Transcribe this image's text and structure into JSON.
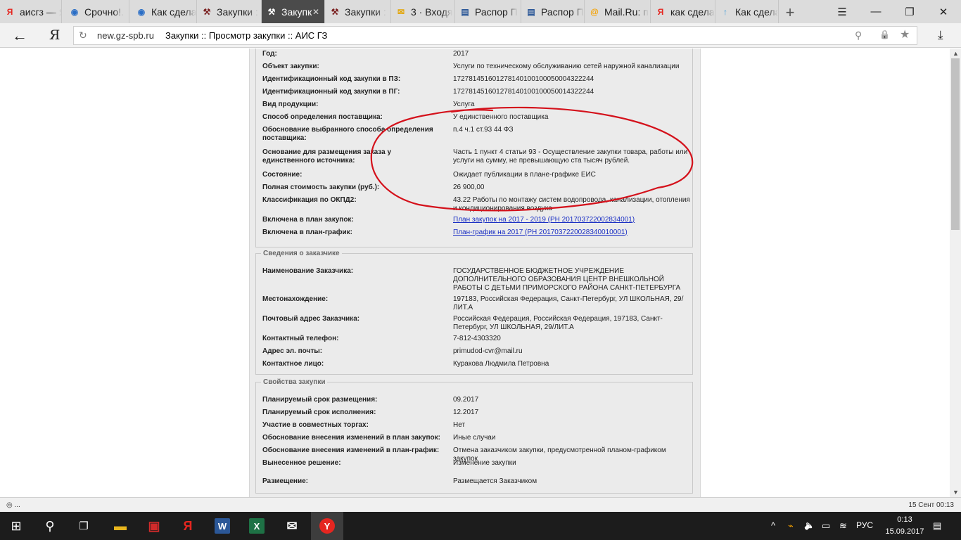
{
  "browser": {
    "tabs": [
      {
        "label": "аисгз — Я",
        "icon": "yandex-icon",
        "icon_glyph": "Я",
        "icon_color": "#e52620"
      },
      {
        "label": "Срочно!.",
        "icon": "globe-icon",
        "icon_glyph": "◉",
        "icon_color": "#2a6ec6"
      },
      {
        "label": "Как сдела",
        "icon": "globe-icon",
        "icon_glyph": "◉",
        "icon_color": "#2a6ec6"
      },
      {
        "label": "Закупки :",
        "icon": "gavel-icon",
        "icon_glyph": "⚒",
        "icon_color": "#7a1f1f"
      },
      {
        "label": "Закупк",
        "icon": "gavel-icon",
        "icon_glyph": "⚒",
        "icon_color": "#ffffff"
      },
      {
        "label": "Закупки :",
        "icon": "gavel-icon",
        "icon_glyph": "⚒",
        "icon_color": "#7a1f1f"
      },
      {
        "label": "3 · Входя",
        "icon": "mail-icon",
        "icon_glyph": "✉",
        "icon_color": "#e3a400"
      },
      {
        "label": "Распор П",
        "icon": "doc-icon",
        "icon_glyph": "▤",
        "icon_color": "#2b5797"
      },
      {
        "label": "Распор П",
        "icon": "doc-icon",
        "icon_glyph": "▤",
        "icon_color": "#2b5797"
      },
      {
        "label": "Mail.Ru: п",
        "icon": "at-icon",
        "icon_glyph": "@",
        "icon_color": "#f5a100"
      },
      {
        "label": "как сдела",
        "icon": "yandex-icon",
        "icon_glyph": "Я",
        "icon_color": "#e52620"
      },
      {
        "label": "Как сдела",
        "icon": "upload-icon",
        "icon_glyph": "↑",
        "icon_color": "#3a9ad9"
      }
    ],
    "new_tab": "+",
    "window_controls": {
      "menu": "☰",
      "minimize": "—",
      "restore": "❐",
      "close": "✕"
    },
    "back": "←",
    "yandex_logo": "Я",
    "reload": "↻",
    "domain": "new.gz-spb.ru",
    "page_title": "Закупки :: Просмотр закупки :: АИС ГЗ",
    "address_icons": {
      "search": "⚲",
      "lock": "🔒",
      "bookmark": "★"
    },
    "download": "⤓"
  },
  "procurement": {
    "rows": [
      {
        "key": "Год:",
        "value": "2017"
      },
      {
        "key": "Объект закупки:",
        "value": "Услуги по техническому обслуживанию сетей наружной канализации"
      },
      {
        "key": "Идентификационный код закупки в ПЗ:",
        "value": "172781451601278140100100050004322244"
      },
      {
        "key": "Идентификационный код закупки в ПГ:",
        "value": "172781451601278140100100050014322244"
      },
      {
        "key": "Вид продукции:",
        "value": "Услуга"
      },
      {
        "key": "Способ определения поставщика:",
        "value": "У единственного поставщика"
      },
      {
        "key": "Обоснование выбранного способа определения поставщика:",
        "value": "п.4 ч.1 ст.93 44 ФЗ"
      },
      {
        "key": "Основание для размещения заказа у единственного источника:",
        "value": "Часть 1 пункт 4 статьи 93 - Осуществление закупки товара, работы или услуги на сумму, не превышающую ста тысяч рублей."
      },
      {
        "key": "Состояние:",
        "value": "Ожидает публикации в плане-графике ЕИС"
      },
      {
        "key": "Полная стоимость закупки (руб.):",
        "value": "26 900,00"
      },
      {
        "key": "Классификация по ОКПД2:",
        "value": "43.22 Работы по монтажу систем водопровода, канализации, отопления и кондиционирования воздуха"
      },
      {
        "key": "Включена в план закупок:",
        "value": "План закупок на 2017 - 2019 (РН 201703722002834001)"
      },
      {
        "key": "Включена в план-график:",
        "value": "План-график на 2017 (РН 2017037220028340010001)"
      }
    ]
  },
  "customer": {
    "legend": "Сведения о заказчике",
    "rows": [
      {
        "key": "Наименование Заказчика:",
        "value": "ГОСУДАРСТВЕННОЕ БЮДЖЕТНОЕ УЧРЕЖДЕНИЕ ДОПОЛНИТЕЛЬНОГО ОБРАЗОВАНИЯ ЦЕНТР ВНЕШКОЛЬНОЙ РАБОТЫ С ДЕТЬМИ ПРИМОРСКОГО РАЙОНА САНКТ-ПЕТЕРБУРГА"
      },
      {
        "key": "Местонахождение:",
        "value": "197183, Российская Федерация, Санкт-Петербург, УЛ ШКОЛЬНАЯ, 29/ ЛИТ.А"
      },
      {
        "key": "Почтовый адрес Заказчика:",
        "value": "Российская Федерация, Российская Федерация, 197183, Санкт-Петербург, УЛ ШКОЛЬНАЯ, 29/ЛИТ.А"
      },
      {
        "key": "Контактный телефон:",
        "value": "7-812-4303320"
      },
      {
        "key": "Адрес эл. почты:",
        "value": "primudod-cvr@mail.ru"
      },
      {
        "key": "Контактное лицо:",
        "value": "Куракова Людмила Петровна"
      }
    ]
  },
  "properties": {
    "legend": "Свойства закупки",
    "rows": [
      {
        "key": "Планируемый срок размещения:",
        "value": "09.2017"
      },
      {
        "key": "Планируемый срок исполнения:",
        "value": "12.2017"
      },
      {
        "key": "Участие в совместных торгах:",
        "value": "Нет"
      },
      {
        "key": "Обоснование внесения изменений в план закупок:",
        "value": "Иные случаи"
      },
      {
        "key": "Обоснование внесения изменений в план-график:",
        "value": "Отмена заказчиком закупки, предусмотренной планом-графиком закупок"
      },
      {
        "key": "Вынесенное решение:",
        "value": "Изменение закупки"
      },
      {
        "key": "Размещение:",
        "value": "Размещается Заказчиком"
      }
    ]
  },
  "annotation": {
    "color": "#d4111b"
  },
  "status_bar": {
    "left": "◎ ...",
    "right": "15 Сент 00:13"
  },
  "taskbar": {
    "start": "⊞",
    "search": "⚲",
    "task_view": "❐",
    "apps": [
      {
        "name": "file-explorer-icon",
        "glyph": "▬",
        "color": "#e8b51d"
      },
      {
        "name": "gift-icon",
        "glyph": "▣",
        "color": "#d22b2b"
      },
      {
        "name": "yandex-browser-icon",
        "glyph": "Я",
        "color": "#e52620"
      },
      {
        "name": "word-icon",
        "glyph": "W",
        "color": "#2b5797"
      },
      {
        "name": "excel-icon",
        "glyph": "X",
        "color": "#1e7145"
      },
      {
        "name": "mail-icon",
        "glyph": "✉",
        "color": "#ffffff"
      },
      {
        "name": "yandex-active-icon",
        "glyph": "Y",
        "color": "#e52620"
      }
    ],
    "tray": {
      "chevron": "^",
      "power": "⌁",
      "volume": "🔈",
      "battery": "▭",
      "network": "≋",
      "lang": "РУС",
      "notifications": "▤"
    },
    "time": "0:13",
    "date": "15.09.2017"
  }
}
